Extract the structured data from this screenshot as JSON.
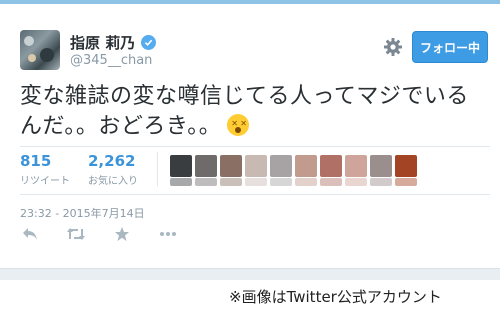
{
  "header": {
    "display_name": "指原 莉乃",
    "handle": "@345__chan",
    "follow_button_label": "フォロー中",
    "icons": {
      "settings": "gear-icon",
      "verified": "verified-badge-icon"
    }
  },
  "tweet": {
    "text": "変な雑誌の変な噂信じてる人ってマジでいるんだ。。おどろき。。",
    "emoji": "astonished-face-emoji"
  },
  "stats": {
    "retweets": {
      "count": "815",
      "label": "リツイート"
    },
    "favorites": {
      "count": "2,262",
      "label": "お気に入り"
    }
  },
  "timestamp": "23:32 - 2015年7月14日",
  "actions": [
    {
      "name": "reply-icon"
    },
    {
      "name": "retweet-icon"
    },
    {
      "name": "favorite-icon"
    },
    {
      "name": "more-icon"
    }
  ],
  "favoriter_colors": [
    "#3a3d40",
    "#6f6b6a",
    "#8a7064",
    "#c9b9b3",
    "#a7a3a5",
    "#c29b8f",
    "#b07066",
    "#cfa49a",
    "#9a8f8c",
    "#a34524",
    "#c4877e",
    "#b9b2b4",
    "#9c9a9d",
    "#dad7d6",
    "#c9c4c6"
  ],
  "caption": "※画像はTwitter公式アカウント",
  "colors": {
    "accent": "#3d9ce4",
    "link": "#3b94d9",
    "muted": "#8899a6",
    "text": "#292f33"
  }
}
